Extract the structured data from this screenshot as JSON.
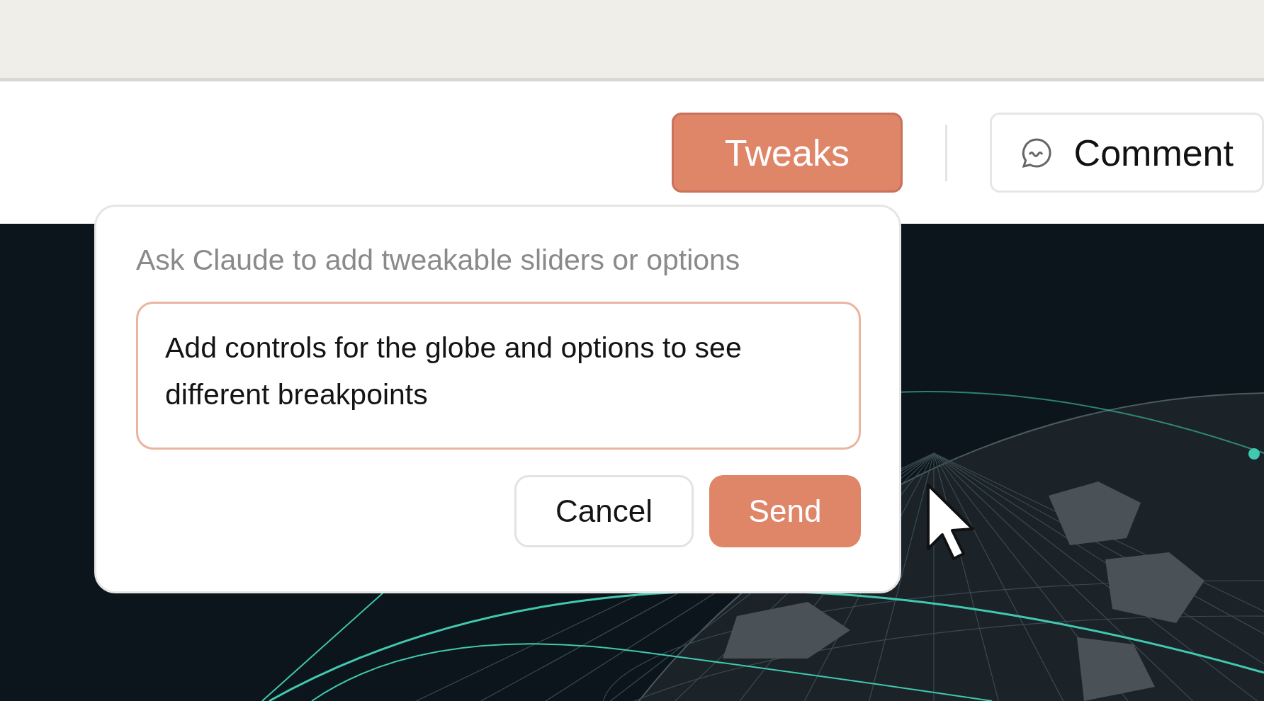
{
  "toolbar": {
    "buttons": [
      {
        "kind": "primary",
        "label": "Tweaks",
        "selected": true
      },
      {
        "kind": "comment",
        "label": "Comment",
        "selected": false
      }
    ]
  },
  "popover": {
    "title": "Ask Claude to add tweakable sliders or options",
    "prompt": {
      "value": "Add controls for the globe and options to see different breakpoints"
    },
    "actions": [
      {
        "kind": "secondary",
        "label": "Cancel"
      },
      {
        "kind": "primary",
        "label": "Send"
      }
    ]
  }
}
